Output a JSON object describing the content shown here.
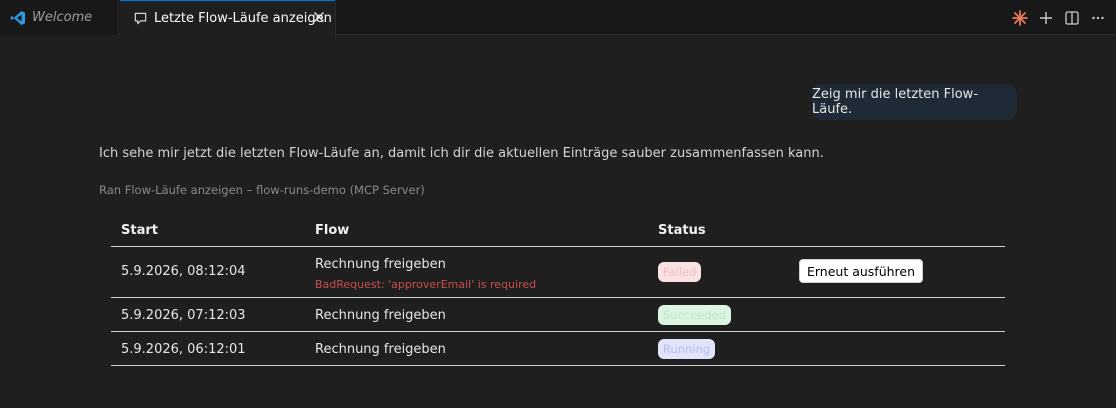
{
  "tabs": [
    {
      "label": "Welcome",
      "icon": "vscode-logo-icon"
    },
    {
      "label": "Letzte Flow-Läufe anzeigen",
      "icon": "chat-icon"
    }
  ],
  "toolbar_icons": [
    "sparkle-icon",
    "plus-icon",
    "split-editor-icon",
    "more-icon"
  ],
  "chat": {
    "user_message": "Zeig mir die letzten Flow-Läufe.",
    "assistant_message": "Ich sehe mir jetzt die letzten Flow-Läufe an, damit ich dir die aktuellen Einträge sauber zusammenfassen kann.",
    "tool_call": "Ran Flow-Läufe anzeigen – flow-runs-demo (MCP Server)"
  },
  "table": {
    "headers": {
      "start": "Start",
      "flow": "Flow",
      "status": "Status"
    },
    "rows": [
      {
        "start": "5.9.2026, 08:12:04",
        "flow": "Rechnung freigeben",
        "error": "BadRequest: 'approverEmail' is required",
        "status": "Failed",
        "action": "Erneut ausführen"
      },
      {
        "start": "5.9.2026, 07:12:03",
        "flow": "Rechnung freigeben",
        "status": "Succeeded"
      },
      {
        "start": "5.9.2026, 06:12:01",
        "flow": "Rechnung freigeben",
        "status": "Running"
      }
    ]
  },
  "colors": {
    "accent": "#0078d4",
    "sparkle": "#e8795a",
    "error_text": "#c74e4e",
    "failed_bg": "#fbe2e2",
    "succeeded_bg": "#dcf5e2",
    "running_bg": "#e2e4fb"
  }
}
